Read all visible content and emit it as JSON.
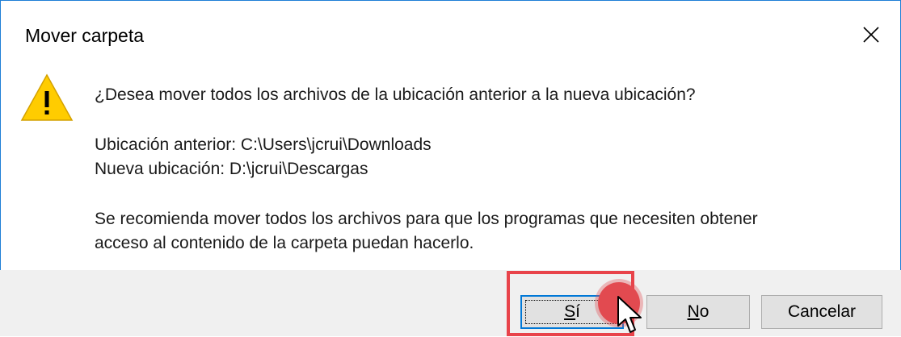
{
  "window": {
    "title": "Mover carpeta",
    "close_glyph": "✕"
  },
  "message": {
    "question": "¿Desea mover todos los archivos de la ubicación anterior a la nueva ubicación?",
    "old_location": "Ubicación anterior: C:\\Users\\jcrui\\Downloads",
    "new_location": "Nueva ubicación: D:\\jcrui\\Descargas",
    "recommendation_line1": "Se recomienda mover todos los archivos para que los programas que necesiten obtener",
    "recommendation_line2": "acceso al contenido de la carpeta puedan hacerlo."
  },
  "buttons": {
    "yes_mnemonic": "S",
    "yes_rest": "í",
    "no_mnemonic": "N",
    "no_rest": "o",
    "cancel": "Cancelar"
  },
  "icons": {
    "warning": "warning-icon",
    "close": "close-icon",
    "cursor": "mouse-pointer-icon"
  },
  "colors": {
    "accent": "#0078d7",
    "border": "#1e7fd6",
    "highlight": "#e8434a",
    "warning_fill": "#ffcc00"
  }
}
